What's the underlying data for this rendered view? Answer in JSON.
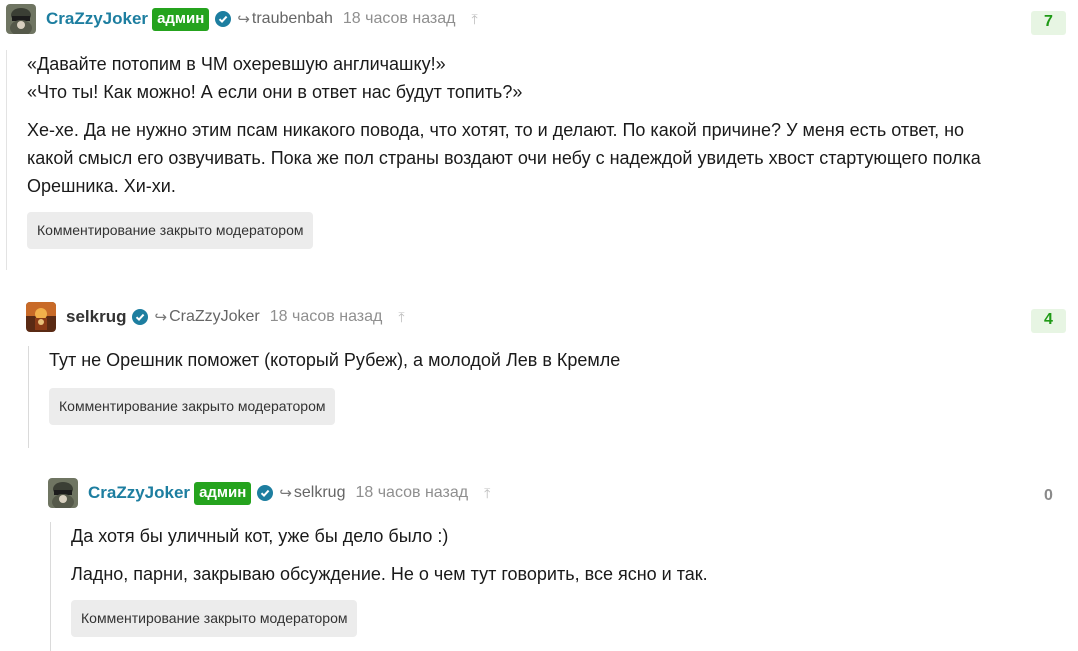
{
  "comments": [
    {
      "username": "CraZzyJoker",
      "badge": "админ",
      "reply_to": "traubenbah",
      "time": "18 часов назад",
      "score": "7",
      "lines": [
        "«Давайте потопим в ЧМ охеревшую англичашку!»",
        "«Что ты! Как можно! А если они в ответ нас будут топить?»",
        "Хе-хе. Да не нужно этим псам никакого повода, что хотят, то и делают. По какой причине? У меня есть ответ, но",
        "какой смысл его озвучивать. Пока же пол страны воздают очи небу с надеждой увидеть хвост стартующего полка",
        "Орешника. Хи-хи."
      ],
      "closed_label": "Комментирование закрыто модератором"
    },
    {
      "username": "selkrug",
      "reply_to": "CraZzyJoker",
      "time": "18 часов назад",
      "score": "4",
      "lines": [
        "Тут не Орешник поможет (который Рубеж), а молодой Лев в Кремле"
      ],
      "closed_label": "Комментирование закрыто модератором"
    },
    {
      "username": "CraZzyJoker",
      "badge": "админ",
      "reply_to": "selkrug",
      "time": "18 часов назад",
      "score": "0",
      "lines": [
        "Да хотя бы уличный кот, уже бы дело было :)",
        "Ладно, парни, закрываю обсуждение. Не о чем тут говорить, все ясно и так."
      ],
      "closed_label": "Комментирование закрыто модератором"
    }
  ],
  "icons": {
    "reply": "↪",
    "scroll_up": "⤒",
    "verified_color": "#1d7ea0",
    "admin_color": "#25a31e",
    "score_positive_color": "#1f9a16"
  }
}
